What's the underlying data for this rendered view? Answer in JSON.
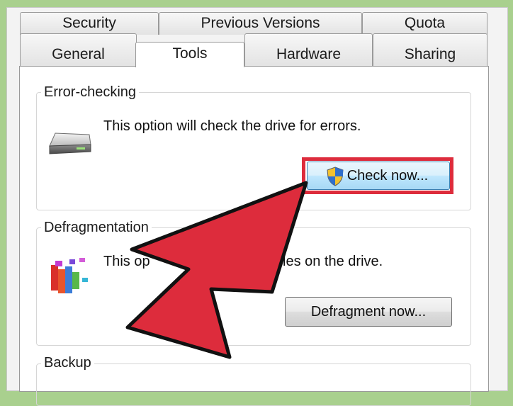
{
  "tabs": {
    "security": "Security",
    "previous_versions": "Previous Versions",
    "quota": "Quota",
    "general": "General",
    "tools": "Tools",
    "hardware": "Hardware",
    "sharing": "Sharing"
  },
  "error_checking": {
    "title": "Error-checking",
    "description": "This option will check the drive for errors.",
    "button": "Check now...",
    "icon": "drive-icon"
  },
  "defragmentation": {
    "title": "Defragmentation",
    "description_start": "This op",
    "description_end": "files on the drive.",
    "button": "Defragment now...",
    "icon": "defrag-icon"
  },
  "backup": {
    "title": "Backup"
  },
  "colors": {
    "arrow_fill": "#dd2c3c",
    "highlight_border": "#dd2c3c",
    "background": "#a9d08e"
  }
}
